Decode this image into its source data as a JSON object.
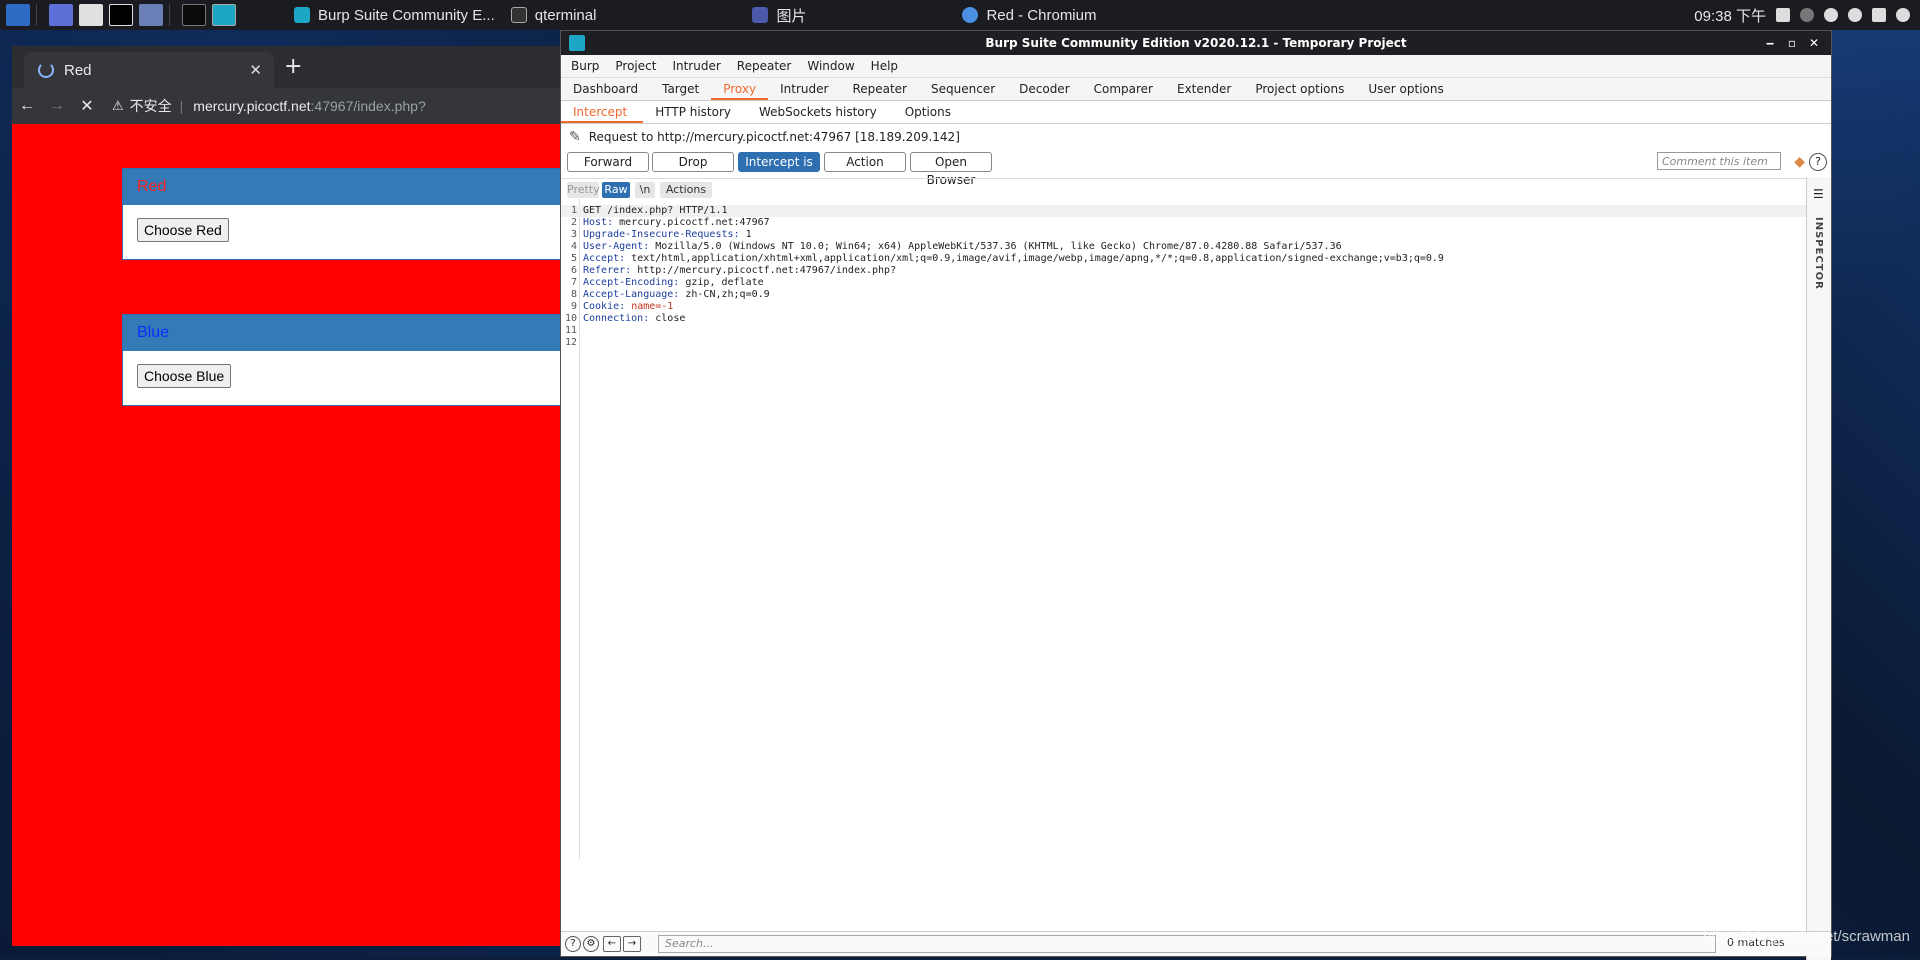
{
  "taskbar": {
    "tasks": [
      {
        "label": "Burp Suite Community E..."
      },
      {
        "label": "qterminal"
      },
      {
        "label": "图片"
      },
      {
        "label": "Red - Chromium"
      }
    ],
    "time": "09:38 下午",
    "colors": {
      "bar": "#1a1c21",
      "burp": "#1ea6c7"
    }
  },
  "chromium": {
    "tab_title": "Red",
    "security_label": "不安全",
    "url_host": "mercury.picoctf.net",
    "url_rest": ":47967/index.php?",
    "page": {
      "background": "#ff0000",
      "panels": [
        {
          "heading": "Red",
          "heading_color": "#ff1f1f",
          "button": "Choose Red"
        },
        {
          "heading": "Blue",
          "heading_color": "#0a2fff",
          "button": "Choose Blue"
        }
      ]
    }
  },
  "burp": {
    "title": "Burp Suite Community Edition v2020.12.1 - Temporary Project",
    "menu": [
      "Burp",
      "Project",
      "Intruder",
      "Repeater",
      "Window",
      "Help"
    ],
    "tabs": [
      "Dashboard",
      "Target",
      "Proxy",
      "Intruder",
      "Repeater",
      "Sequencer",
      "Decoder",
      "Comparer",
      "Extender",
      "Project options",
      "User options"
    ],
    "active_tab": "Proxy",
    "subtabs": [
      "Intercept",
      "HTTP history",
      "WebSockets history",
      "Options"
    ],
    "active_subtab": "Intercept",
    "request_to": "Request to http://mercury.picoctf.net:47967 [18.189.209.142]",
    "buttons": {
      "forward": "Forward",
      "drop": "Drop",
      "intercept": "Intercept is on",
      "action": "Action",
      "open_browser": "Open Browser"
    },
    "comment_placeholder": "Comment this item",
    "editor_buttons": {
      "pretty": "Pretty",
      "raw": "Raw",
      "newline": "\\n",
      "actions": "Actions"
    },
    "request_lines": [
      {
        "n": "1",
        "key": "",
        "value": "GET /index.php? HTTP/1.1"
      },
      {
        "n": "2",
        "key": "Host:",
        "value": "mercury.picoctf.net:47967"
      },
      {
        "n": "3",
        "key": "Upgrade-Insecure-Requests:",
        "value": "1"
      },
      {
        "n": "4",
        "key": "User-Agent:",
        "value": "Mozilla/5.0 (Windows NT 10.0; Win64; x64) AppleWebKit/537.36 (KHTML, like Gecko) Chrome/87.0.4280.88 Safari/537.36"
      },
      {
        "n": "5",
        "key": "Accept:",
        "value": "text/html,application/xhtml+xml,application/xml;q=0.9,image/avif,image/webp,image/apng,*/*;q=0.8,application/signed-exchange;v=b3;q=0.9"
      },
      {
        "n": "6",
        "key": "Referer:",
        "value": "http://mercury.picoctf.net:47967/index.php?"
      },
      {
        "n": "7",
        "key": "Accept-Encoding:",
        "value": "gzip, deflate"
      },
      {
        "n": "8",
        "key": "Accept-Language:",
        "value": "zh-CN,zh;q=0.9"
      },
      {
        "n": "9",
        "key": "Cookie:",
        "value": "name=-1"
      },
      {
        "n": "10",
        "key": "Connection:",
        "value": "close"
      },
      {
        "n": "11",
        "key": "",
        "value": ""
      },
      {
        "n": "12",
        "key": "",
        "value": ""
      }
    ],
    "inspector_label": "INSPECTOR",
    "search_placeholder": "Search...",
    "matches": "0 matches",
    "colors": {
      "accent": "#f06a2e",
      "button_on": "#2e6fb2"
    }
  },
  "watermark": "https://blog.csdn.net/scrawman"
}
